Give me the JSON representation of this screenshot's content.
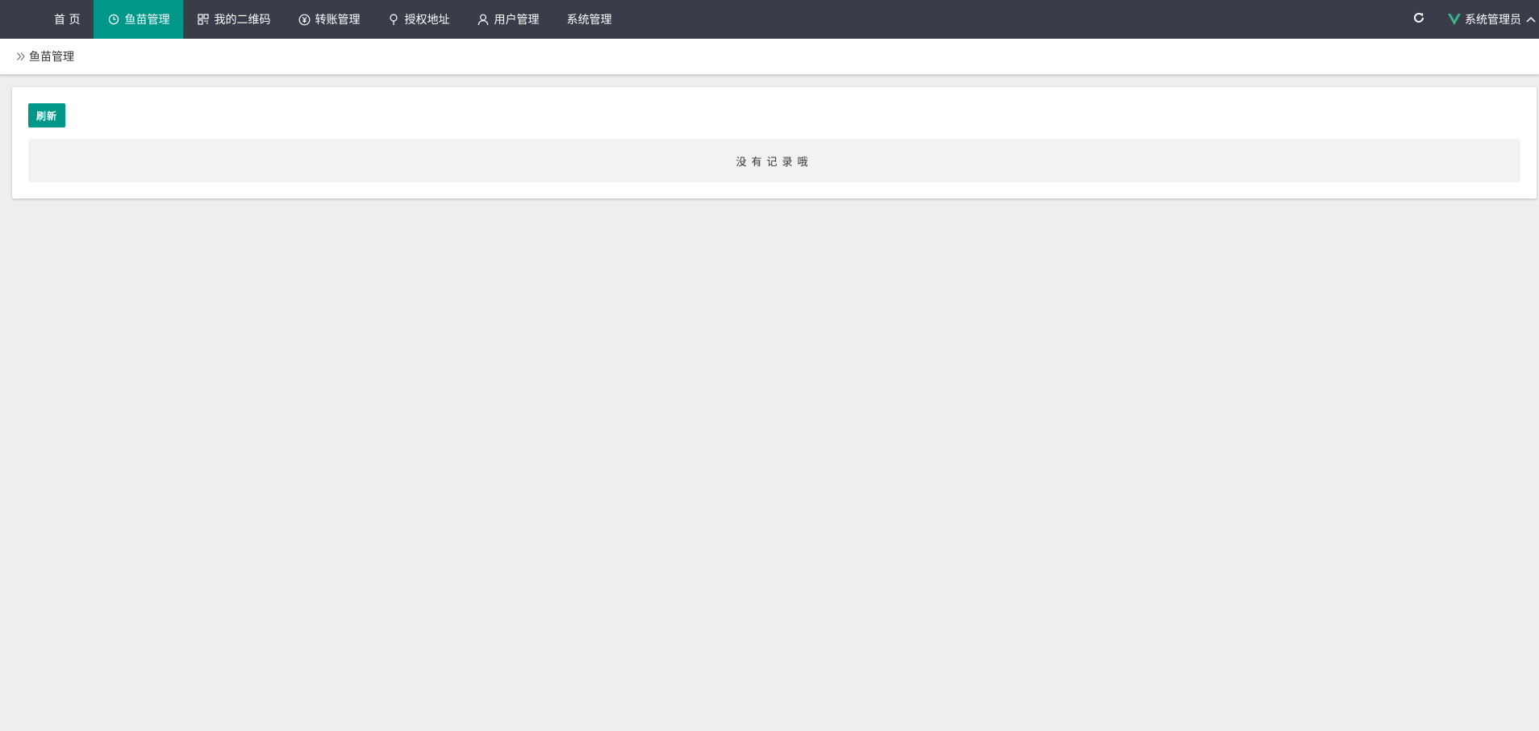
{
  "nav": {
    "items": [
      {
        "label": "首 页",
        "icon": "none",
        "active": false
      },
      {
        "label": "鱼苗管理",
        "icon": "fish-icon",
        "active": true
      },
      {
        "label": "我的二维码",
        "icon": "qrcode-icon",
        "active": false
      },
      {
        "label": "转账管理",
        "icon": "yen-icon",
        "active": false
      },
      {
        "label": "授权地址",
        "icon": "location-pin-icon",
        "active": false
      },
      {
        "label": "用户管理",
        "icon": "user-icon",
        "active": false
      },
      {
        "label": "系统管理",
        "icon": "none",
        "active": false
      }
    ]
  },
  "header": {
    "refresh_icon": "refresh-icon",
    "user_name": "系统管理员",
    "logo_icon": "vue-logo-icon"
  },
  "breadcrumb": {
    "current": "鱼苗管理"
  },
  "toolbar": {
    "refresh_label": "刷新"
  },
  "table": {
    "empty_text": "没有记录哦"
  },
  "colors": {
    "topbar": "#393d49",
    "accent": "#009688",
    "background": "#eeeeee"
  }
}
